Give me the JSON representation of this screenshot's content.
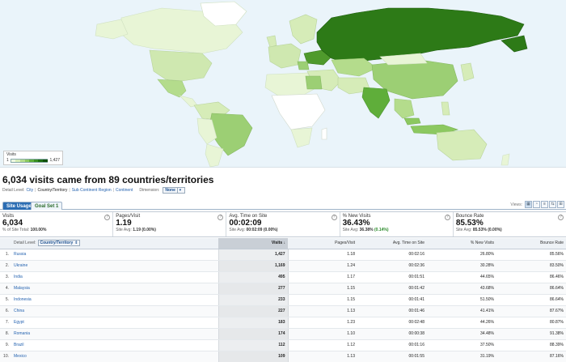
{
  "map": {
    "legend_title": "Visits",
    "legend_min": "1",
    "legend_max": "1,427",
    "legend_colors": [
      "#eef7e0",
      "#d6ecb8",
      "#b4dc8c",
      "#8cc860",
      "#5fae3a",
      "#3a8f22",
      "#1f6e12",
      "#0f4f08"
    ],
    "ocean_color": "#eaf4fa",
    "land_no_data": "#ffffff",
    "highest_color": "#2d7a17",
    "high_color": "#5aa83a",
    "mid_color": "#9ccf74",
    "low_color": "#d7edbd"
  },
  "headline": "6,034 visits came from 89 countries/territories",
  "detail_level": {
    "label": "Detail Level:",
    "options": [
      "City",
      "Country/Territory",
      "Sub Continent Region",
      "Continent"
    ],
    "active": "Country/Territory",
    "dimension_label": "Dimension:",
    "dimension_value": "None"
  },
  "tabs": [
    {
      "label": "Site Usage",
      "active": true
    },
    {
      "label": "Goal Set 1",
      "active": false
    }
  ],
  "views_label": "Views:",
  "metrics": [
    {
      "label": "Visits",
      "value": "6,034",
      "sub_prefix": "% of Site Total:",
      "sub_value": "100.00%",
      "sub_extra": ""
    },
    {
      "label": "Pages/Visit",
      "value": "1.19",
      "sub_prefix": "Site Avg:",
      "sub_value": "1.19 (0.00%)",
      "sub_extra": ""
    },
    {
      "label": "Avg. Time on Site",
      "value": "00:02:09",
      "sub_prefix": "Site Avg:",
      "sub_value": "00:02:09 (0.00%)",
      "sub_extra": ""
    },
    {
      "label": "% New Visits",
      "value": "36.43%",
      "sub_prefix": "Site Avg:",
      "sub_value": "36.38%",
      "sub_extra": "(0.14%)"
    },
    {
      "label": "Bounce Rate",
      "value": "85.53%",
      "sub_prefix": "Site Avg:",
      "sub_value": "85.53% (0.00%)",
      "sub_extra": ""
    }
  ],
  "table": {
    "detail_label": "Detail Level:",
    "detail_value": "Country/Territory",
    "columns": {
      "visits": "Visits",
      "pages": "Pages/Visit",
      "time": "Avg. Time on Site",
      "new": "% New Visits",
      "bounce": "Bounce Rate"
    },
    "rows": [
      {
        "n": "1.",
        "country": "Russia",
        "visits": "1,427",
        "pages": "1.18",
        "time": "00:02:16",
        "new": "26.80%",
        "bounce": "85.56%"
      },
      {
        "n": "2.",
        "country": "Ukraine",
        "visits": "1,169",
        "pages": "1.24",
        "time": "00:02:36",
        "new": "30.28%",
        "bounce": "83.50%"
      },
      {
        "n": "3.",
        "country": "India",
        "visits": "495",
        "pages": "1.17",
        "time": "00:01:51",
        "new": "44.65%",
        "bounce": "86.46%"
      },
      {
        "n": "4.",
        "country": "Malaysia",
        "visits": "277",
        "pages": "1.15",
        "time": "00:01:42",
        "new": "43.68%",
        "bounce": "86.64%"
      },
      {
        "n": "5.",
        "country": "Indonesia",
        "visits": "233",
        "pages": "1.15",
        "time": "00:01:41",
        "new": "51.50%",
        "bounce": "86.64%"
      },
      {
        "n": "6.",
        "country": "China",
        "visits": "227",
        "pages": "1.13",
        "time": "00:01:46",
        "new": "41.41%",
        "bounce": "87.67%"
      },
      {
        "n": "7.",
        "country": "Egypt",
        "visits": "183",
        "pages": "1.23",
        "time": "00:02:48",
        "new": "44.26%",
        "bounce": "80.87%"
      },
      {
        "n": "8.",
        "country": "Romania",
        "visits": "174",
        "pages": "1.10",
        "time": "00:00:38",
        "new": "34.48%",
        "bounce": "91.38%"
      },
      {
        "n": "9.",
        "country": "Brazil",
        "visits": "112",
        "pages": "1.12",
        "time": "00:01:16",
        "new": "37.50%",
        "bounce": "88.39%"
      },
      {
        "n": "10.",
        "country": "Mexico",
        "visits": "109",
        "pages": "1.13",
        "time": "00:01:55",
        "new": "31.19%",
        "bounce": "87.16%"
      }
    ]
  }
}
